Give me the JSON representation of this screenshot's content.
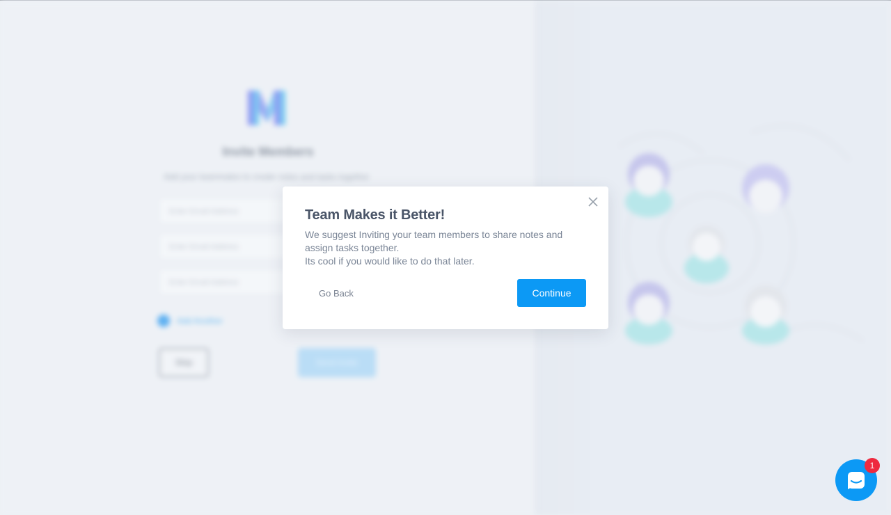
{
  "background": {
    "title": "Invite Members",
    "subtitle": "Add your teammates to create notes and tasks together",
    "inputs": [
      {
        "placeholder": "Enter Email Address"
      },
      {
        "placeholder": "Enter Email Address"
      },
      {
        "placeholder": "Enter Email Address"
      }
    ],
    "add_another_label": "Add Another",
    "skip_label": "Skip",
    "send_label": "Send Invite",
    "logo_icon": "app-logo-icon",
    "illustration_icon": "team-illustration"
  },
  "modal": {
    "title": "Team Makes it Better!",
    "body_line1": "We suggest Inviting your team members to share notes and assign tasks together.",
    "body_line2": "Its cool if you would like to do that later.",
    "go_back_label": "Go Back",
    "continue_label": "Continue",
    "close_icon": "close-icon"
  },
  "chat": {
    "icon": "chat-icon",
    "badge_count": "1"
  },
  "colors": {
    "accent": "#0c99f5",
    "badge": "#ee2a3f",
    "title_text": "#4a5568",
    "body_text": "#7a8596"
  }
}
